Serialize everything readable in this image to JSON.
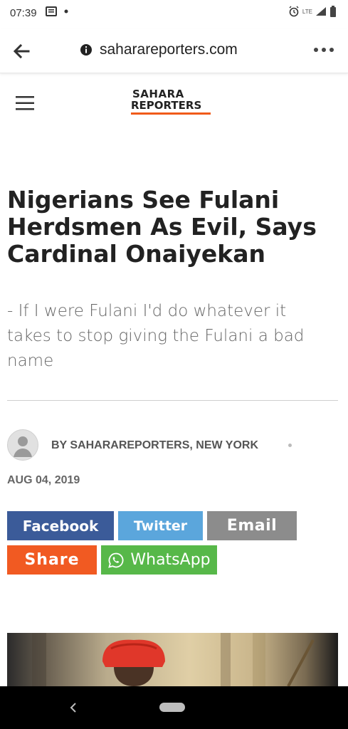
{
  "status_bar": {
    "time": "07:39",
    "signal_label": "LTE"
  },
  "browser": {
    "url": "saharareporters.com"
  },
  "site": {
    "logo_top": "SAHARA",
    "logo_bottom": "REPORTERS"
  },
  "article": {
    "title": "Nigerians See Fulani Herdsmen As Evil, Says Cardinal Onaiyekan",
    "subtitle": "- If I were Fulani I'd do whatever it takes to stop giving the Fulani a bad name",
    "byline": "BY SAHARAREPORTERS, NEW YORK",
    "date": "AUG 04, 2019"
  },
  "share": {
    "facebook": "Facebook",
    "twitter": "Twitter",
    "email": "Email",
    "share": "Share",
    "whatsapp": "WhatsApp"
  },
  "colors": {
    "facebook": "#3b5b99",
    "twitter": "#5ba6dc",
    "email": "#8c8c8c",
    "share": "#f15a22",
    "whatsapp": "#57b849",
    "logo_accent": "#f05a1a"
  },
  "icons": [
    "back-arrow-icon",
    "info-icon",
    "more-options-icon",
    "hamburger-menu-icon",
    "alarm-icon",
    "signal-icon",
    "battery-icon",
    "whatsapp-icon",
    "avatar-placeholder-icon"
  ]
}
